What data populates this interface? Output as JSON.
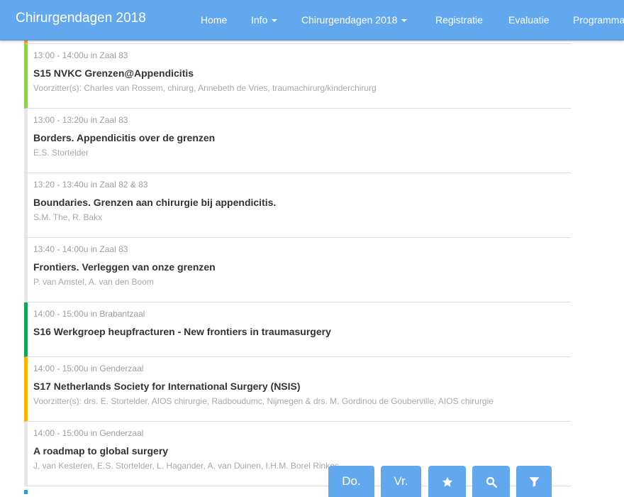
{
  "navbar": {
    "brand": "Chirurgendagen 2018",
    "links": [
      {
        "label": "Home"
      },
      {
        "label": "Info"
      },
      {
        "label": "Chirurgendagen 2018"
      },
      {
        "label": "Registratie"
      },
      {
        "label": "Evaluatie"
      },
      {
        "label": "Programma"
      }
    ]
  },
  "sessions": [
    {
      "time": "13:00 - 14:00u in Zaal 83",
      "title": "S15 NVKC Grenzen@Appendicitis",
      "speakers": "Voorzitter(s): Charles van Rossem, chirurg, Annebeth de Vries, traumachirurg/kinderchirurg",
      "color": "#8fd14f"
    },
    {
      "time": "13:00 - 13:20u in Zaal 83",
      "title": "Borders. Appendicitis over de grenzen",
      "speakers": "E.S. Stortelder",
      "color": "#e6e6e6"
    },
    {
      "time": "13:20 - 13:40u in Zaal 82 & 83",
      "title": "Boundaries. Grenzen aan chirurgie bij appendicitis.",
      "speakers": "S.M. The, R. Bakx",
      "color": "#e6e6e6"
    },
    {
      "time": "13:40 - 14:00u in Zaal 83",
      "title": "Frontiers. Verleggen van onze grenzen",
      "speakers": "P. van Amstel, A. van den Boom",
      "color": "#e6e6e6"
    },
    {
      "time": "14:00 - 15:00u in Brabantzaal",
      "title": "S16 Werkgroep heupfracturen - New frontiers in traumasurgery",
      "speakers": "",
      "color": "#13a455"
    },
    {
      "time": "14:00 - 15:00u in Genderzaal",
      "title": "S17 Netherlands Society for International Surgery (NSIS)",
      "speakers": "Voorzitter(s): drs. E. Stortelder, AIOS chirurgie, Radboudumc, Nijmegen & drs. M. Gordinou de Gouberville, AIOS chirurgie",
      "color": "#f5b400"
    },
    {
      "time": "14:00 - 15:00u in Genderzaal",
      "title": "A roadmap to global surgery",
      "speakers": "J. van Kesteren, E.S. Stortelder, L. Hagander, A. van Duinen, I.H.M. Borel Rinkes",
      "color": "#e6e6e6"
    }
  ],
  "fabs": {
    "day1": "Do.",
    "day2": "Vr.",
    "favorites_icon": "star-icon",
    "search_icon": "search-icon",
    "filter_icon": "filter-icon"
  },
  "colors": {
    "navbar": "#62a8ee",
    "accent_top": "#f5a623",
    "accent_bottom": "#2f9bd6"
  }
}
